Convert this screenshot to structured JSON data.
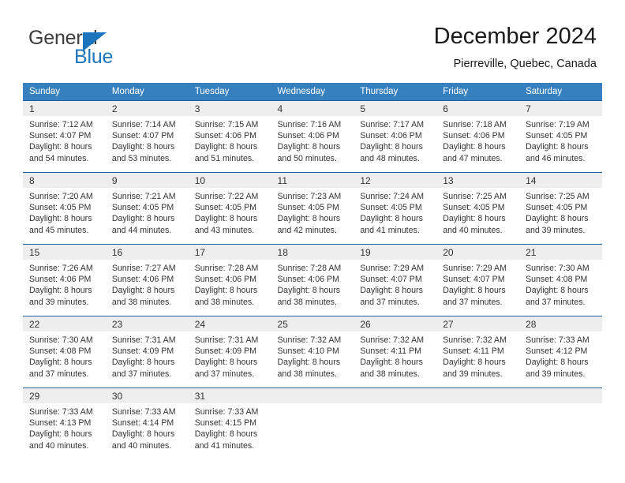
{
  "logo": {
    "text_top": "General",
    "text_bottom": "Blue",
    "triangle_color": "#1c75bc",
    "top_color": "#3c3c3c"
  },
  "header": {
    "title": "December 2024",
    "subtitle": "Pierreville, Quebec, Canada"
  },
  "theme": {
    "header_bg": "#3680bf",
    "header_text": "#ffffff",
    "day_band_bg": "#eeeeee",
    "grid_line": "#1c5f9e",
    "body_text": "#333333"
  },
  "weekdays": [
    "Sunday",
    "Monday",
    "Tuesday",
    "Wednesday",
    "Thursday",
    "Friday",
    "Saturday"
  ],
  "labels": {
    "sunrise_prefix": "Sunrise:",
    "sunset_prefix": "Sunset:",
    "daylight_prefix": "Daylight:"
  },
  "weeks": [
    [
      {
        "day": "1",
        "sunrise": "Sunrise: 7:12 AM",
        "sunset": "Sunset: 4:07 PM",
        "daylight1": "Daylight: 8 hours",
        "daylight2": "and 54 minutes."
      },
      {
        "day": "2",
        "sunrise": "Sunrise: 7:14 AM",
        "sunset": "Sunset: 4:07 PM",
        "daylight1": "Daylight: 8 hours",
        "daylight2": "and 53 minutes."
      },
      {
        "day": "3",
        "sunrise": "Sunrise: 7:15 AM",
        "sunset": "Sunset: 4:06 PM",
        "daylight1": "Daylight: 8 hours",
        "daylight2": "and 51 minutes."
      },
      {
        "day": "4",
        "sunrise": "Sunrise: 7:16 AM",
        "sunset": "Sunset: 4:06 PM",
        "daylight1": "Daylight: 8 hours",
        "daylight2": "and 50 minutes."
      },
      {
        "day": "5",
        "sunrise": "Sunrise: 7:17 AM",
        "sunset": "Sunset: 4:06 PM",
        "daylight1": "Daylight: 8 hours",
        "daylight2": "and 48 minutes."
      },
      {
        "day": "6",
        "sunrise": "Sunrise: 7:18 AM",
        "sunset": "Sunset: 4:06 PM",
        "daylight1": "Daylight: 8 hours",
        "daylight2": "and 47 minutes."
      },
      {
        "day": "7",
        "sunrise": "Sunrise: 7:19 AM",
        "sunset": "Sunset: 4:05 PM",
        "daylight1": "Daylight: 8 hours",
        "daylight2": "and 46 minutes."
      }
    ],
    [
      {
        "day": "8",
        "sunrise": "Sunrise: 7:20 AM",
        "sunset": "Sunset: 4:05 PM",
        "daylight1": "Daylight: 8 hours",
        "daylight2": "and 45 minutes."
      },
      {
        "day": "9",
        "sunrise": "Sunrise: 7:21 AM",
        "sunset": "Sunset: 4:05 PM",
        "daylight1": "Daylight: 8 hours",
        "daylight2": "and 44 minutes."
      },
      {
        "day": "10",
        "sunrise": "Sunrise: 7:22 AM",
        "sunset": "Sunset: 4:05 PM",
        "daylight1": "Daylight: 8 hours",
        "daylight2": "and 43 minutes."
      },
      {
        "day": "11",
        "sunrise": "Sunrise: 7:23 AM",
        "sunset": "Sunset: 4:05 PM",
        "daylight1": "Daylight: 8 hours",
        "daylight2": "and 42 minutes."
      },
      {
        "day": "12",
        "sunrise": "Sunrise: 7:24 AM",
        "sunset": "Sunset: 4:05 PM",
        "daylight1": "Daylight: 8 hours",
        "daylight2": "and 41 minutes."
      },
      {
        "day": "13",
        "sunrise": "Sunrise: 7:25 AM",
        "sunset": "Sunset: 4:05 PM",
        "daylight1": "Daylight: 8 hours",
        "daylight2": "and 40 minutes."
      },
      {
        "day": "14",
        "sunrise": "Sunrise: 7:25 AM",
        "sunset": "Sunset: 4:05 PM",
        "daylight1": "Daylight: 8 hours",
        "daylight2": "and 39 minutes."
      }
    ],
    [
      {
        "day": "15",
        "sunrise": "Sunrise: 7:26 AM",
        "sunset": "Sunset: 4:06 PM",
        "daylight1": "Daylight: 8 hours",
        "daylight2": "and 39 minutes."
      },
      {
        "day": "16",
        "sunrise": "Sunrise: 7:27 AM",
        "sunset": "Sunset: 4:06 PM",
        "daylight1": "Daylight: 8 hours",
        "daylight2": "and 38 minutes."
      },
      {
        "day": "17",
        "sunrise": "Sunrise: 7:28 AM",
        "sunset": "Sunset: 4:06 PM",
        "daylight1": "Daylight: 8 hours",
        "daylight2": "and 38 minutes."
      },
      {
        "day": "18",
        "sunrise": "Sunrise: 7:28 AM",
        "sunset": "Sunset: 4:06 PM",
        "daylight1": "Daylight: 8 hours",
        "daylight2": "and 38 minutes."
      },
      {
        "day": "19",
        "sunrise": "Sunrise: 7:29 AM",
        "sunset": "Sunset: 4:07 PM",
        "daylight1": "Daylight: 8 hours",
        "daylight2": "and 37 minutes."
      },
      {
        "day": "20",
        "sunrise": "Sunrise: 7:29 AM",
        "sunset": "Sunset: 4:07 PM",
        "daylight1": "Daylight: 8 hours",
        "daylight2": "and 37 minutes."
      },
      {
        "day": "21",
        "sunrise": "Sunrise: 7:30 AM",
        "sunset": "Sunset: 4:08 PM",
        "daylight1": "Daylight: 8 hours",
        "daylight2": "and 37 minutes."
      }
    ],
    [
      {
        "day": "22",
        "sunrise": "Sunrise: 7:30 AM",
        "sunset": "Sunset: 4:08 PM",
        "daylight1": "Daylight: 8 hours",
        "daylight2": "and 37 minutes."
      },
      {
        "day": "23",
        "sunrise": "Sunrise: 7:31 AM",
        "sunset": "Sunset: 4:09 PM",
        "daylight1": "Daylight: 8 hours",
        "daylight2": "and 37 minutes."
      },
      {
        "day": "24",
        "sunrise": "Sunrise: 7:31 AM",
        "sunset": "Sunset: 4:09 PM",
        "daylight1": "Daylight: 8 hours",
        "daylight2": "and 37 minutes."
      },
      {
        "day": "25",
        "sunrise": "Sunrise: 7:32 AM",
        "sunset": "Sunset: 4:10 PM",
        "daylight1": "Daylight: 8 hours",
        "daylight2": "and 38 minutes."
      },
      {
        "day": "26",
        "sunrise": "Sunrise: 7:32 AM",
        "sunset": "Sunset: 4:11 PM",
        "daylight1": "Daylight: 8 hours",
        "daylight2": "and 38 minutes."
      },
      {
        "day": "27",
        "sunrise": "Sunrise: 7:32 AM",
        "sunset": "Sunset: 4:11 PM",
        "daylight1": "Daylight: 8 hours",
        "daylight2": "and 39 minutes."
      },
      {
        "day": "28",
        "sunrise": "Sunrise: 7:33 AM",
        "sunset": "Sunset: 4:12 PM",
        "daylight1": "Daylight: 8 hours",
        "daylight2": "and 39 minutes."
      }
    ],
    [
      {
        "day": "29",
        "sunrise": "Sunrise: 7:33 AM",
        "sunset": "Sunset: 4:13 PM",
        "daylight1": "Daylight: 8 hours",
        "daylight2": "and 40 minutes."
      },
      {
        "day": "30",
        "sunrise": "Sunrise: 7:33 AM",
        "sunset": "Sunset: 4:14 PM",
        "daylight1": "Daylight: 8 hours",
        "daylight2": "and 40 minutes."
      },
      {
        "day": "31",
        "sunrise": "Sunrise: 7:33 AM",
        "sunset": "Sunset: 4:15 PM",
        "daylight1": "Daylight: 8 hours",
        "daylight2": "and 41 minutes."
      },
      {
        "day": "",
        "sunrise": "",
        "sunset": "",
        "daylight1": "",
        "daylight2": ""
      },
      {
        "day": "",
        "sunrise": "",
        "sunset": "",
        "daylight1": "",
        "daylight2": ""
      },
      {
        "day": "",
        "sunrise": "",
        "sunset": "",
        "daylight1": "",
        "daylight2": ""
      },
      {
        "day": "",
        "sunrise": "",
        "sunset": "",
        "daylight1": "",
        "daylight2": ""
      }
    ]
  ]
}
